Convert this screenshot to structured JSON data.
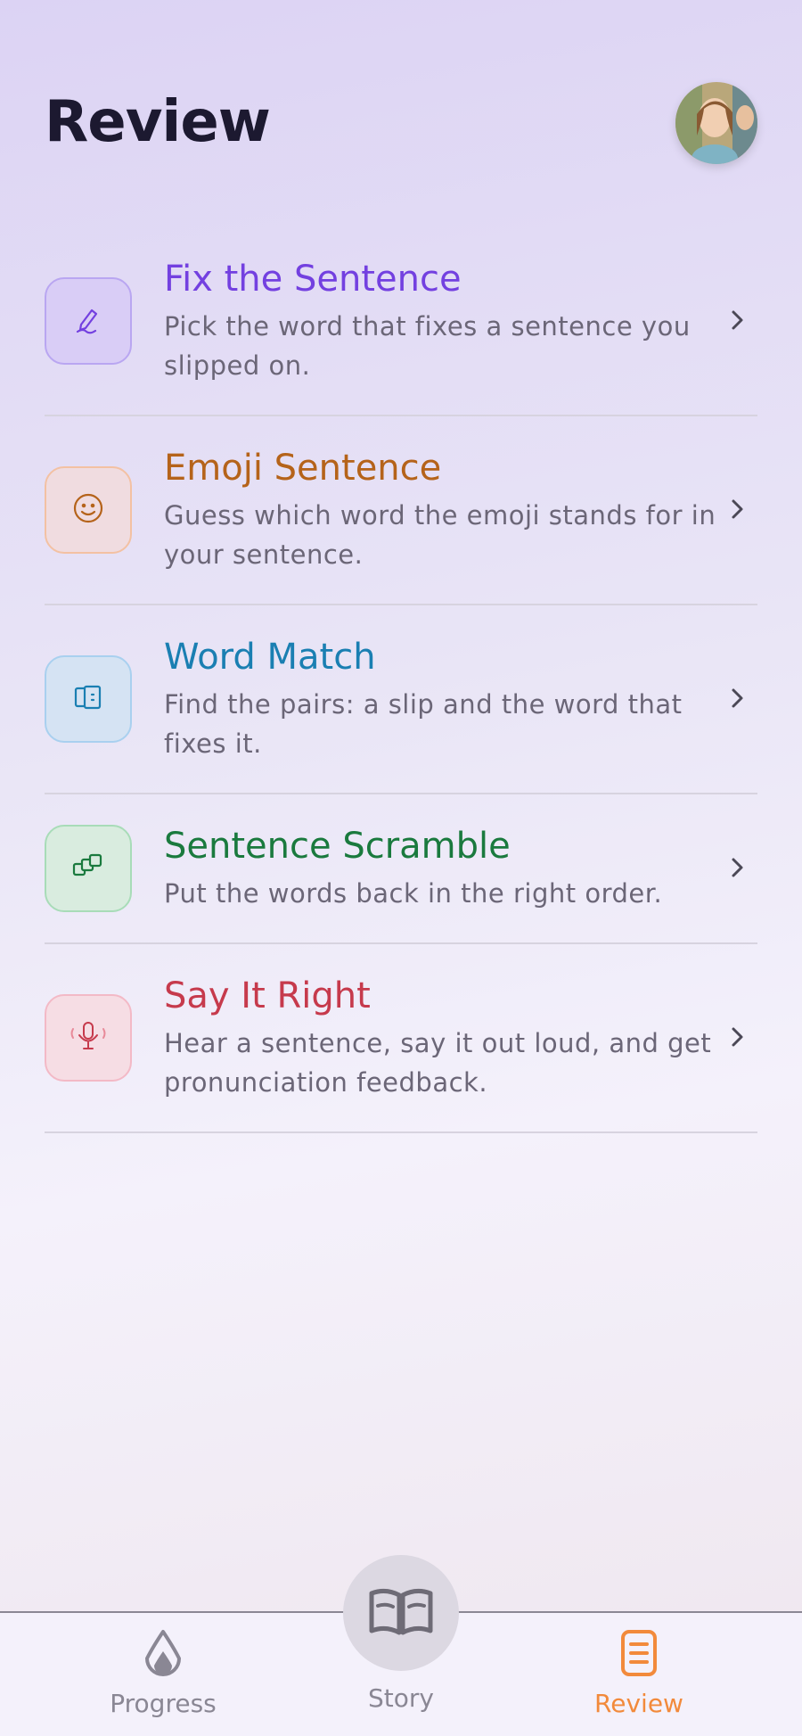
{
  "header": {
    "title": "Review"
  },
  "items": [
    {
      "title": "Fix the Sentence",
      "desc": "Pick the word that fixes a sentence you slipped on.",
      "icon": "pencil-icon",
      "color": "#7340e0",
      "bg": "#d9cdf6",
      "border": "#b9a6f1"
    },
    {
      "title": "Emoji Sentence",
      "desc": "Guess which word the emoji stands for in your sentence.",
      "icon": "smiley-icon",
      "color": "#b5631a",
      "bg": "#f0dce0",
      "border": "#f3c1a3"
    },
    {
      "title": "Word Match",
      "desc": "Find the pairs: a slip and the word that fixes it.",
      "icon": "cards-icon",
      "color": "#1a7fb2",
      "bg": "#d5e3f3",
      "border": "#a9d0ef"
    },
    {
      "title": "Sentence Scramble",
      "desc": "Put the words back in the right order.",
      "icon": "blocks-icon",
      "color": "#1a7a3e",
      "bg": "#d9ecdf",
      "border": "#a8dcb8"
    },
    {
      "title": "Say It Right",
      "desc": "Hear a sentence, say it out loud, and get pronunciation feedback.",
      "icon": "microphone-icon",
      "color": "#c63a4c",
      "bg": "#f6dde4",
      "border": "#f3b9c6"
    }
  ],
  "tabs": {
    "progress": "Progress",
    "story": "Story",
    "review": "Review"
  }
}
